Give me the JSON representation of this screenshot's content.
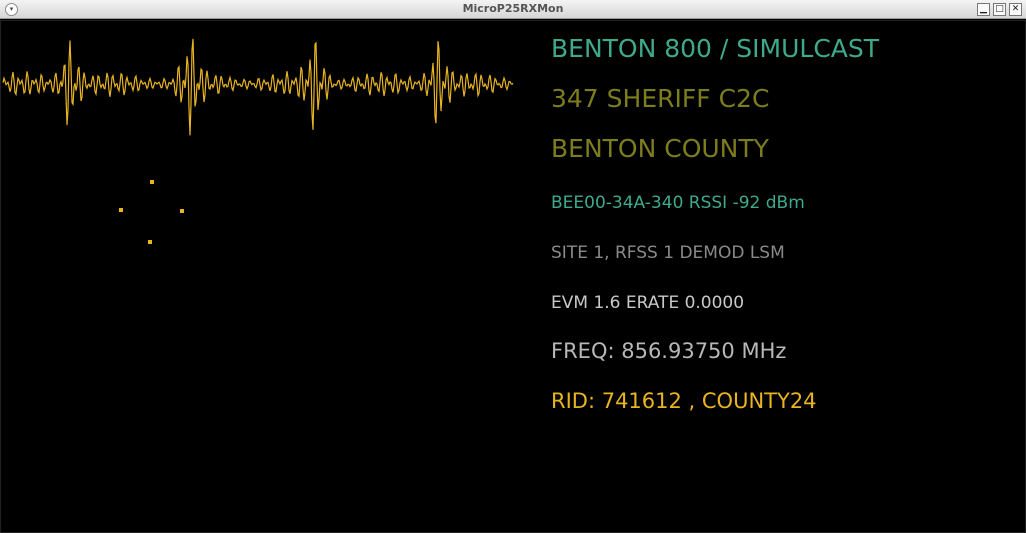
{
  "window": {
    "title": "MicroP25RXMon"
  },
  "titlebar": {
    "menu_icon": "window-menu-icon",
    "minimize": "▁",
    "maximize": "□",
    "close": "✕"
  },
  "colors": {
    "waveform": "#e8b422",
    "constellation": "#e8b422"
  },
  "info": {
    "system_name": "BENTON 800 / SIMULCAST",
    "talkgroup": "347  SHERIFF C2C",
    "group_name": "BENTON COUNTY",
    "site_info": "BEE00-34A-340  RSSI -92 dBm",
    "site_detail": "SITE 1, RFSS 1 DEMOD LSM",
    "evm_erate": "EVM 1.6  ERATE 0.0000",
    "freq": "FREQ: 856.93750 MHz",
    "rid": "RID: 741612 , COUNTY24"
  }
}
